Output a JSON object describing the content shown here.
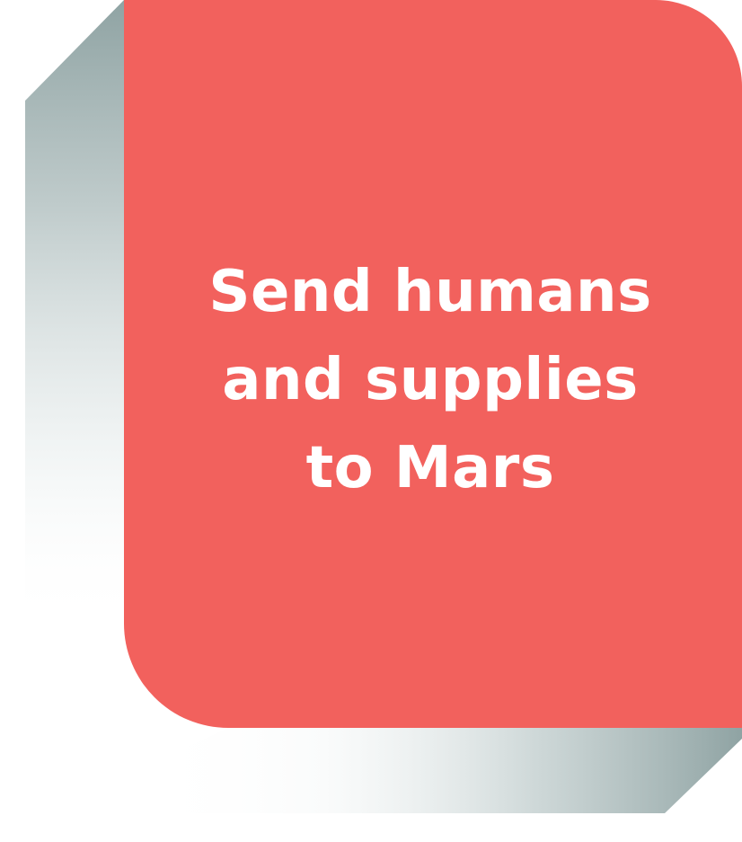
{
  "card": {
    "lines": [
      "Send humans",
      "and supplies",
      "to Mars"
    ],
    "background_color": "#f2615d",
    "text_color": "#ffffff",
    "shadow_color": "#8fa3a3"
  }
}
